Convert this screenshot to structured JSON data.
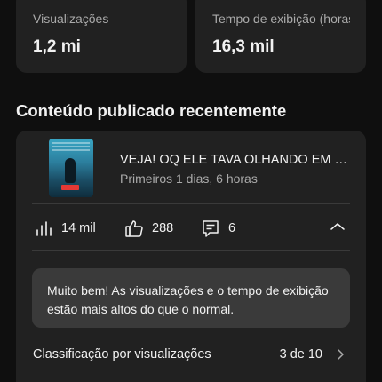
{
  "stats": [
    {
      "label": "Visualizações",
      "value": "1,2 mi"
    },
    {
      "label": "Tempo de exibição (horas)",
      "value": "16,3 mil"
    }
  ],
  "section": {
    "title": "Conteúdo publicado recentemente"
  },
  "video": {
    "title": "VEJA! OQ ELE TAVA OLHANDO EM SEU CELULAR",
    "subtitle": "Primeiros 1 dias, 6 horas",
    "thumbnail_icon": "video-thumbnail"
  },
  "metrics": {
    "views": {
      "icon": "bar-chart-icon",
      "value": "14 mil"
    },
    "likes": {
      "icon": "thumbs-up-icon",
      "value": "288"
    },
    "comments": {
      "icon": "comment-icon",
      "value": "6"
    },
    "collapse_icon": "chevron-up-icon"
  },
  "message": "Muito bem! As visualizações e o tempo de exibição estão mais altos do que o normal.",
  "ranking": {
    "label": "Classificação por visualizações",
    "value": "3 de 10",
    "icon": "chevron-right-icon"
  },
  "colors": {
    "background": "#0f0f0f",
    "card": "#212121",
    "message_box": "#3a3a3a",
    "text_primary": "#f1f1f1",
    "text_secondary": "#aaaaaa"
  }
}
